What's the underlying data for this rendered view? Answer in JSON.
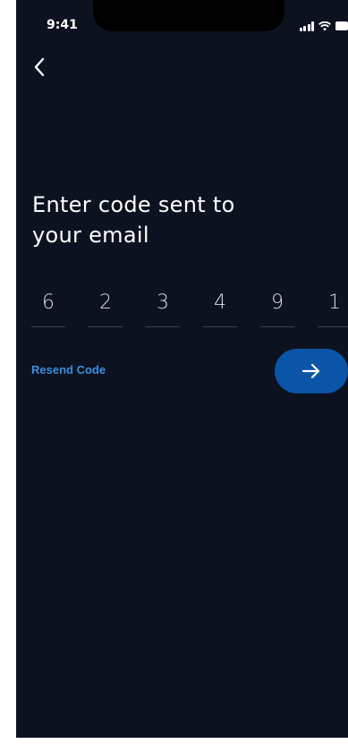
{
  "status_bar": {
    "time": "9:41"
  },
  "title": "Enter code sent to\nyour email",
  "code": [
    "6",
    "2",
    "3",
    "4",
    "9",
    "1"
  ],
  "resend_label": "Resend Code",
  "colors": {
    "background": "#0c1220",
    "accent": "#3d8ee0",
    "button": "#0a55a8",
    "text": "#ffffff"
  },
  "icons": {
    "back": "chevron-left-icon",
    "next": "arrow-right-icon",
    "signal": "cellular-signal-icon",
    "wifi": "wifi-icon",
    "battery": "battery-icon"
  }
}
